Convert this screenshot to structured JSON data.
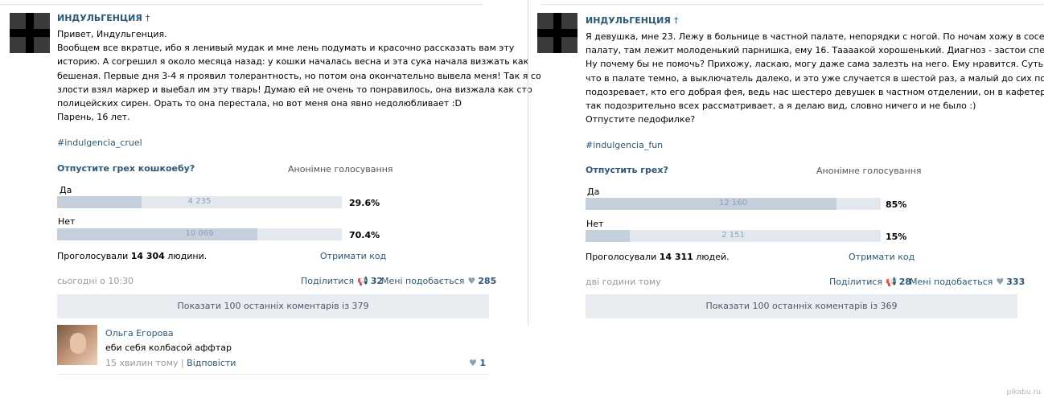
{
  "left_post": {
    "author": "ИНДУЛЬГЕНЦИЯ",
    "author_mark": "†",
    "text_lines": [
      "Привет, Индульгенция.",
      "Вообщем все вкратце, ибо я ленивый мудак и мне лень подумать и красочно рассказать вам эту",
      "историю. А согрешил я около месяца назад: у кошки началась весна и эта сука начала визжать как",
      "бешеная. Первые дня 3-4 я проявил толерантность, но потом она окончательно вывела меня! Так я со",
      "злости взял маркер и выебал им эту тварь! Думаю ей не очень то понравилось, она визжала как сто",
      "полицейских сирен. Орать то она перестала, но вот меня она явно недолюбливает :D",
      "Парень, 16 лет."
    ],
    "hashtag": "#indulgencia_cruel",
    "poll": {
      "question": "Отпустите грех кошкоебу?",
      "anon_label": "Анонімне голосування",
      "options": [
        {
          "label": "Да",
          "count": "4 235",
          "percent": "29.6%",
          "fraction": 0.296
        },
        {
          "label": "Нет",
          "count": "10 069",
          "percent": "70.4%",
          "fraction": 0.704
        }
      ],
      "voted_prefix": "Проголосували",
      "voted_count": "14 304",
      "voted_suffix": "людини.",
      "get_code": "Отримати код"
    },
    "time": "сьогодні о 10:30",
    "share_label": "Поділитися",
    "share_count": "32",
    "like_label": "Мені подобається",
    "like_count": "285",
    "comments_button": "Показати 100 останніх коментарів із 379",
    "comment": {
      "name": "Ольга Егорова",
      "text": "еби себя колбасой аффтар",
      "time": "15 хвилин тому",
      "separator": "|",
      "reply": "Відповісти",
      "likes": "1"
    }
  },
  "right_post": {
    "author": "ИНДУЛЬГЕНЦИЯ",
    "author_mark": "†",
    "text_lines": [
      "Я девушка, мне 23. Лежу в больнице в частной палате, непорядки с ногой. По ночам хожу в соседнюю",
      "палату, там лежит молоденький парнишка, ему 16. Таааакой хорошенький. Диагноз - застои спермы.",
      "Ну почему бы не помочь? Прихожу, ласкаю, могу даже сама залезть на него. Ему нравится. Суть в том,",
      "что в палате темно, а выключатель далеко, и это уже случается в шестой раз, а малый до сих пор не",
      "подозревает, кто его добрая фея, ведь нас шестеро девушек в частном отделении, он в кафетерии",
      "так подозрительно всех рассматривает, а я делаю вид, словно ничего и не было :)",
      "Отпустите педофилке?"
    ],
    "hashtag": "#indulgencia_fun",
    "poll": {
      "question": "Отпустить грех?",
      "anon_label": "Анонімне голосування",
      "options": [
        {
          "label": "Да",
          "count": "12 160",
          "percent": "85%",
          "fraction": 0.85
        },
        {
          "label": "Нет",
          "count": "2 151",
          "percent": "15%",
          "fraction": 0.15
        }
      ],
      "voted_prefix": "Проголосували",
      "voted_count": "14 311",
      "voted_suffix": "людей.",
      "get_code": "Отримати код"
    },
    "time": "дві години тому",
    "share_label": "Поділитися",
    "share_count": "28",
    "like_label": "Мені подобається",
    "like_count": "333",
    "comments_button": "Показати 100 останніх коментарів із 369"
  },
  "watermark": "pikabu.ru",
  "colors": {
    "link": "#2b587a",
    "bar_bg": "#e3e8ee",
    "bar_fill": "#c4d0db",
    "button_bg": "#e9edf1"
  }
}
